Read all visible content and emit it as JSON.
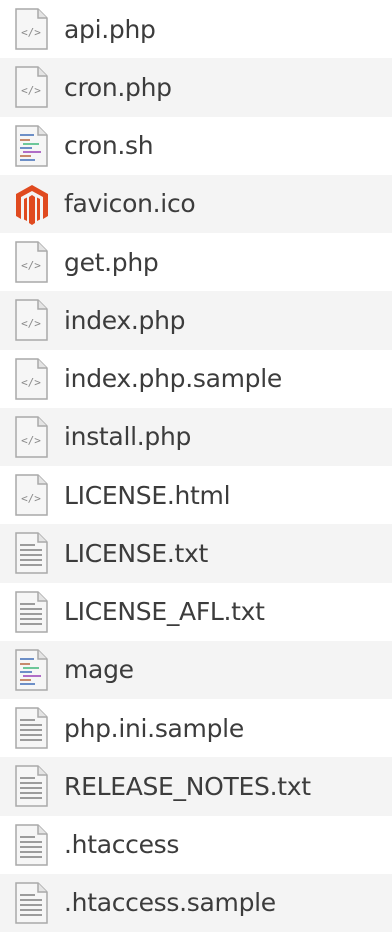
{
  "files": [
    {
      "name": "api.php",
      "icon": "php-file-icon"
    },
    {
      "name": "cron.php",
      "icon": "php-file-icon"
    },
    {
      "name": "cron.sh",
      "icon": "shell-script-icon"
    },
    {
      "name": "favicon.ico",
      "icon": "magento-logo-icon"
    },
    {
      "name": "get.php",
      "icon": "php-file-icon"
    },
    {
      "name": "index.php",
      "icon": "php-file-icon"
    },
    {
      "name": "index.php.sample",
      "icon": "php-file-icon"
    },
    {
      "name": "install.php",
      "icon": "php-file-icon"
    },
    {
      "name": "LICENSE.html",
      "icon": "html-file-icon"
    },
    {
      "name": "LICENSE.txt",
      "icon": "text-file-icon"
    },
    {
      "name": "LICENSE_AFL.txt",
      "icon": "text-file-icon"
    },
    {
      "name": "mage",
      "icon": "shell-script-icon"
    },
    {
      "name": "php.ini.sample",
      "icon": "text-file-icon"
    },
    {
      "name": "RELEASE_NOTES.txt",
      "icon": "text-file-icon"
    },
    {
      "name": ".htaccess",
      "icon": "text-file-icon"
    },
    {
      "name": ".htaccess.sample",
      "icon": "text-file-icon"
    }
  ],
  "colors": {
    "row_alt": "#f4f4f4",
    "text": "#3c3c3c",
    "magento_orange": "#e04a1f"
  }
}
